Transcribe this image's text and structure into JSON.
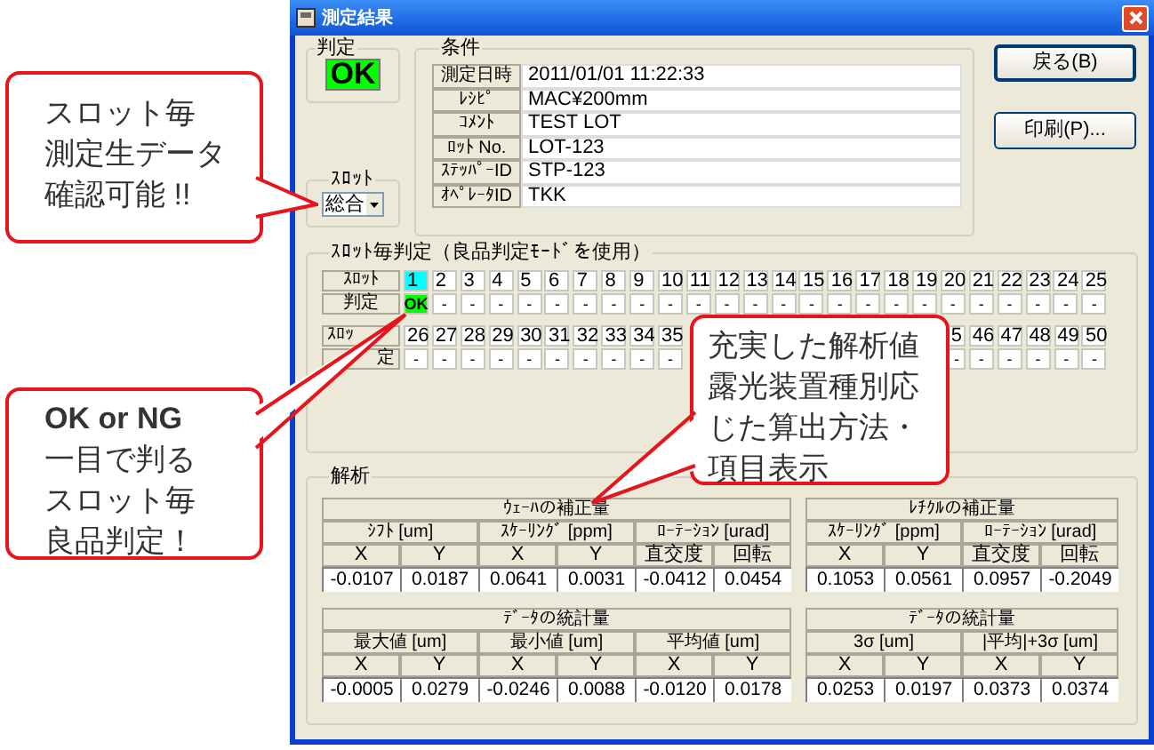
{
  "window": {
    "title": "測定結果"
  },
  "judgement": {
    "label": "判定",
    "result": "OK",
    "kind": "ok"
  },
  "slot": {
    "label": "ｽﾛｯﾄ",
    "value": "総合"
  },
  "conditions": {
    "label": "条件",
    "rows": [
      {
        "label": "測定日時",
        "value": "2011/01/01 11:22:33"
      },
      {
        "label": "ﾚｼﾋﾟ",
        "value": "MAC¥200mm"
      },
      {
        "label": "ｺﾒﾝﾄ",
        "value": "TEST LOT"
      },
      {
        "label": "ﾛｯﾄ No.",
        "value": "LOT-123"
      },
      {
        "label": "ｽﾃｯﾊﾟｰID",
        "value": "STP-123"
      },
      {
        "label": "ｵﾍﾟﾚｰﾀID",
        "value": "TKK"
      }
    ]
  },
  "buttons": [
    "戻る(B)",
    "印刷(P)..."
  ],
  "slot_judgement": {
    "label": "ｽﾛｯﾄ毎判定（良品判定ﾓｰﾄﾞを使用）",
    "blocks": [
      {
        "slot_label": "ｽﾛｯﾄ",
        "result_label": "判定",
        "slots": [
          {
            "number": "1",
            "result": "OK",
            "kind": "ok",
            "selected": true
          },
          {
            "number": "2",
            "result": "-",
            "kind": "none",
            "selected": false
          },
          {
            "number": "3",
            "result": "-",
            "kind": "none",
            "selected": false
          },
          {
            "number": "4",
            "result": "-",
            "kind": "none",
            "selected": false
          },
          {
            "number": "5",
            "result": "-",
            "kind": "none",
            "selected": false
          },
          {
            "number": "6",
            "result": "-",
            "kind": "none",
            "selected": false
          },
          {
            "number": "7",
            "result": "-",
            "kind": "none",
            "selected": false
          },
          {
            "number": "8",
            "result": "-",
            "kind": "none",
            "selected": false
          },
          {
            "number": "9",
            "result": "-",
            "kind": "none",
            "selected": false
          },
          {
            "number": "10",
            "result": "-",
            "kind": "none",
            "selected": false
          },
          {
            "number": "11",
            "result": "-",
            "kind": "none",
            "selected": false
          },
          {
            "number": "12",
            "result": "-",
            "kind": "none",
            "selected": false
          },
          {
            "number": "13",
            "result": "-",
            "kind": "none",
            "selected": false
          },
          {
            "number": "14",
            "result": "-",
            "kind": "none",
            "selected": false
          },
          {
            "number": "15",
            "result": "-",
            "kind": "none",
            "selected": false
          },
          {
            "number": "16",
            "result": "-",
            "kind": "none",
            "selected": false
          },
          {
            "number": "17",
            "result": "-",
            "kind": "none",
            "selected": false
          },
          {
            "number": "18",
            "result": "-",
            "kind": "none",
            "selected": false
          },
          {
            "number": "19",
            "result": "-",
            "kind": "none",
            "selected": false
          },
          {
            "number": "20",
            "result": "-",
            "kind": "none",
            "selected": false
          },
          {
            "number": "21",
            "result": "-",
            "kind": "none",
            "selected": false
          },
          {
            "number": "22",
            "result": "-",
            "kind": "none",
            "selected": false
          },
          {
            "number": "23",
            "result": "-",
            "kind": "none",
            "selected": false
          },
          {
            "number": "24",
            "result": "-",
            "kind": "none",
            "selected": false
          },
          {
            "number": "25",
            "result": "-",
            "kind": "none",
            "selected": false
          }
        ]
      },
      {
        "slot_label": "ｽﾛｯ",
        "result_label": "定",
        "slots": [
          {
            "number": "26",
            "result": "-",
            "kind": "none",
            "selected": false
          },
          {
            "number": "27",
            "result": "-",
            "kind": "none",
            "selected": false
          },
          {
            "number": "28",
            "result": "-",
            "kind": "none",
            "selected": false
          },
          {
            "number": "29",
            "result": "-",
            "kind": "none",
            "selected": false
          },
          {
            "number": "30",
            "result": "-",
            "kind": "none",
            "selected": false
          },
          {
            "number": "31",
            "result": "-",
            "kind": "none",
            "selected": false
          },
          {
            "number": "32",
            "result": "-",
            "kind": "none",
            "selected": false
          },
          {
            "number": "33",
            "result": "-",
            "kind": "none",
            "selected": false
          },
          {
            "number": "34",
            "result": "-",
            "kind": "none",
            "selected": false
          },
          {
            "number": "35",
            "result": "-",
            "kind": "none",
            "selected": false
          }
        ],
        "slots_right": [
          {
            "number": "5",
            "result": "-",
            "kind": "none",
            "selected": false
          },
          {
            "number": "46",
            "result": "-",
            "kind": "none",
            "selected": false
          },
          {
            "number": "47",
            "result": "-",
            "kind": "none",
            "selected": false
          },
          {
            "number": "48",
            "result": "-",
            "kind": "none",
            "selected": false
          },
          {
            "number": "49",
            "result": "-",
            "kind": "none",
            "selected": false
          },
          {
            "number": "50",
            "result": "-",
            "kind": "none",
            "selected": false
          }
        ]
      }
    ]
  },
  "analysis": {
    "label": "解析",
    "tables": [
      {
        "title": "ｳｪｰﾊの補正量",
        "groups": [
          {
            "label": "ｼﾌﾄ [um]",
            "columns": [
              "X",
              "Y"
            ]
          },
          {
            "label": "ｽｹｰﾘﾝｸﾞ [ppm]",
            "columns": [
              "X",
              "Y"
            ]
          },
          {
            "label": "ﾛｰﾃｰｼｮﾝ [urad]",
            "columns": [
              "直交度",
              "回転"
            ]
          }
        ],
        "values": [
          "-0.0107",
          "0.0187",
          "0.0641",
          "0.0031",
          "-0.0412",
          "0.0454"
        ]
      },
      {
        "title": "ﾚﾁｸﾙの補正量",
        "groups": [
          {
            "label": "ｽｹｰﾘﾝｸﾞ [ppm]",
            "columns": [
              "X",
              "Y"
            ]
          },
          {
            "label": "ﾛｰﾃｰｼｮﾝ [urad]",
            "columns": [
              "直交度",
              "回転"
            ]
          }
        ],
        "values": [
          "0.1053",
          "0.0561",
          "0.0957",
          "-0.2049"
        ]
      },
      {
        "title": "ﾃﾞｰﾀの統計量",
        "groups": [
          {
            "label": "最大値 [um]",
            "columns": [
              "X",
              "Y"
            ]
          },
          {
            "label": "最小値 [um]",
            "columns": [
              "X",
              "Y"
            ]
          },
          {
            "label": "平均値 [um]",
            "columns": [
              "X",
              "Y"
            ]
          }
        ],
        "values": [
          "-0.0005",
          "0.0279",
          "-0.0246",
          "0.0088",
          "-0.0120",
          "0.0178"
        ]
      },
      {
        "title": "ﾃﾞｰﾀの統計量",
        "groups": [
          {
            "label": "3σ [um]",
            "columns": [
              "X",
              "Y"
            ]
          },
          {
            "label": "|平均|+3σ [um]",
            "columns": [
              "X",
              "Y"
            ]
          }
        ],
        "values": [
          "0.0253",
          "0.0197",
          "0.0373",
          "0.0374"
        ]
      }
    ]
  },
  "callouts": [
    {
      "lines": [
        {
          "text": "スロット毎",
          "bold": false
        },
        {
          "text": "測定生データ",
          "bold": false
        },
        {
          "text": "確認可能 !!",
          "bold": false
        }
      ]
    },
    {
      "lines": [
        {
          "text": "OK or NG",
          "bold": true
        },
        {
          "text": "一目で判る",
          "bold": false
        },
        {
          "text": "スロット毎",
          "bold": false
        },
        {
          "text": "良品判定！",
          "bold": false
        }
      ]
    },
    {
      "lines": [
        {
          "text": "充実した解析値",
          "bold": false
        },
        {
          "text": "露光装置種別応",
          "bold": false
        },
        {
          "text": "じた算出方法・",
          "bold": false
        },
        {
          "text": "項目表示",
          "bold": false
        }
      ]
    }
  ]
}
